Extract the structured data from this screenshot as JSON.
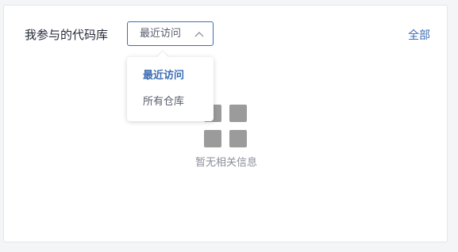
{
  "panel": {
    "title": "我参与的代码库",
    "all_link": "全部"
  },
  "filter": {
    "selected": "最近访问",
    "options": [
      "最近访问",
      "所有仓库"
    ],
    "chevron_icon": "chevron-up-icon"
  },
  "empty": {
    "icon": "grid-icon",
    "message": "暂无相关信息"
  },
  "colors": {
    "accent": "#3c6eb4",
    "icon_gray": "#9b9b9b",
    "muted_text": "#8a8e99"
  }
}
